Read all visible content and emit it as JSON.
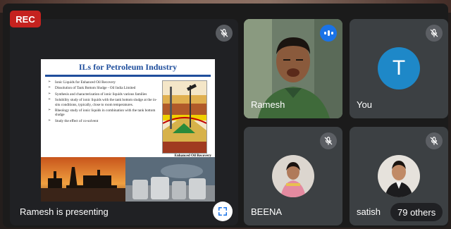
{
  "recording": {
    "label": "REC",
    "color": "#c5221f"
  },
  "presentation": {
    "caption": "Ramesh is presenting",
    "slide": {
      "title": "ILs for Petroleum Industry",
      "bullets": [
        "Ionic Liquids for Enhanced Oil Recovery",
        "Dissolution of Tank Bottom Sludge - Oil India Limited",
        "Synthesis and characterization of ionic liquids various families",
        "Solubility study of ionic liquids with the tank bottom sludge at the in-situ conditions, typically, close to room temperatures.",
        "Rheology study of ionic liquids in combination with the tank bottom sludge",
        "Study the effect of co-solvent"
      ],
      "image_caption": "Enhanced Oil Recovery"
    },
    "fullscreen_icon": "fullscreen-icon",
    "mic_icon": "mic-off-icon"
  },
  "participants": [
    {
      "name": "Ramesh",
      "state": "speaking",
      "icon": "speaking-icon"
    },
    {
      "name": "You",
      "avatar_letter": "T",
      "avatar_color": "#1e88c8",
      "icon": "mic-off-icon"
    },
    {
      "name": "BEENA",
      "icon": "mic-off-icon"
    },
    {
      "name": "satish",
      "icon": "mic-off-icon"
    }
  ],
  "others": {
    "label": "79 others"
  }
}
